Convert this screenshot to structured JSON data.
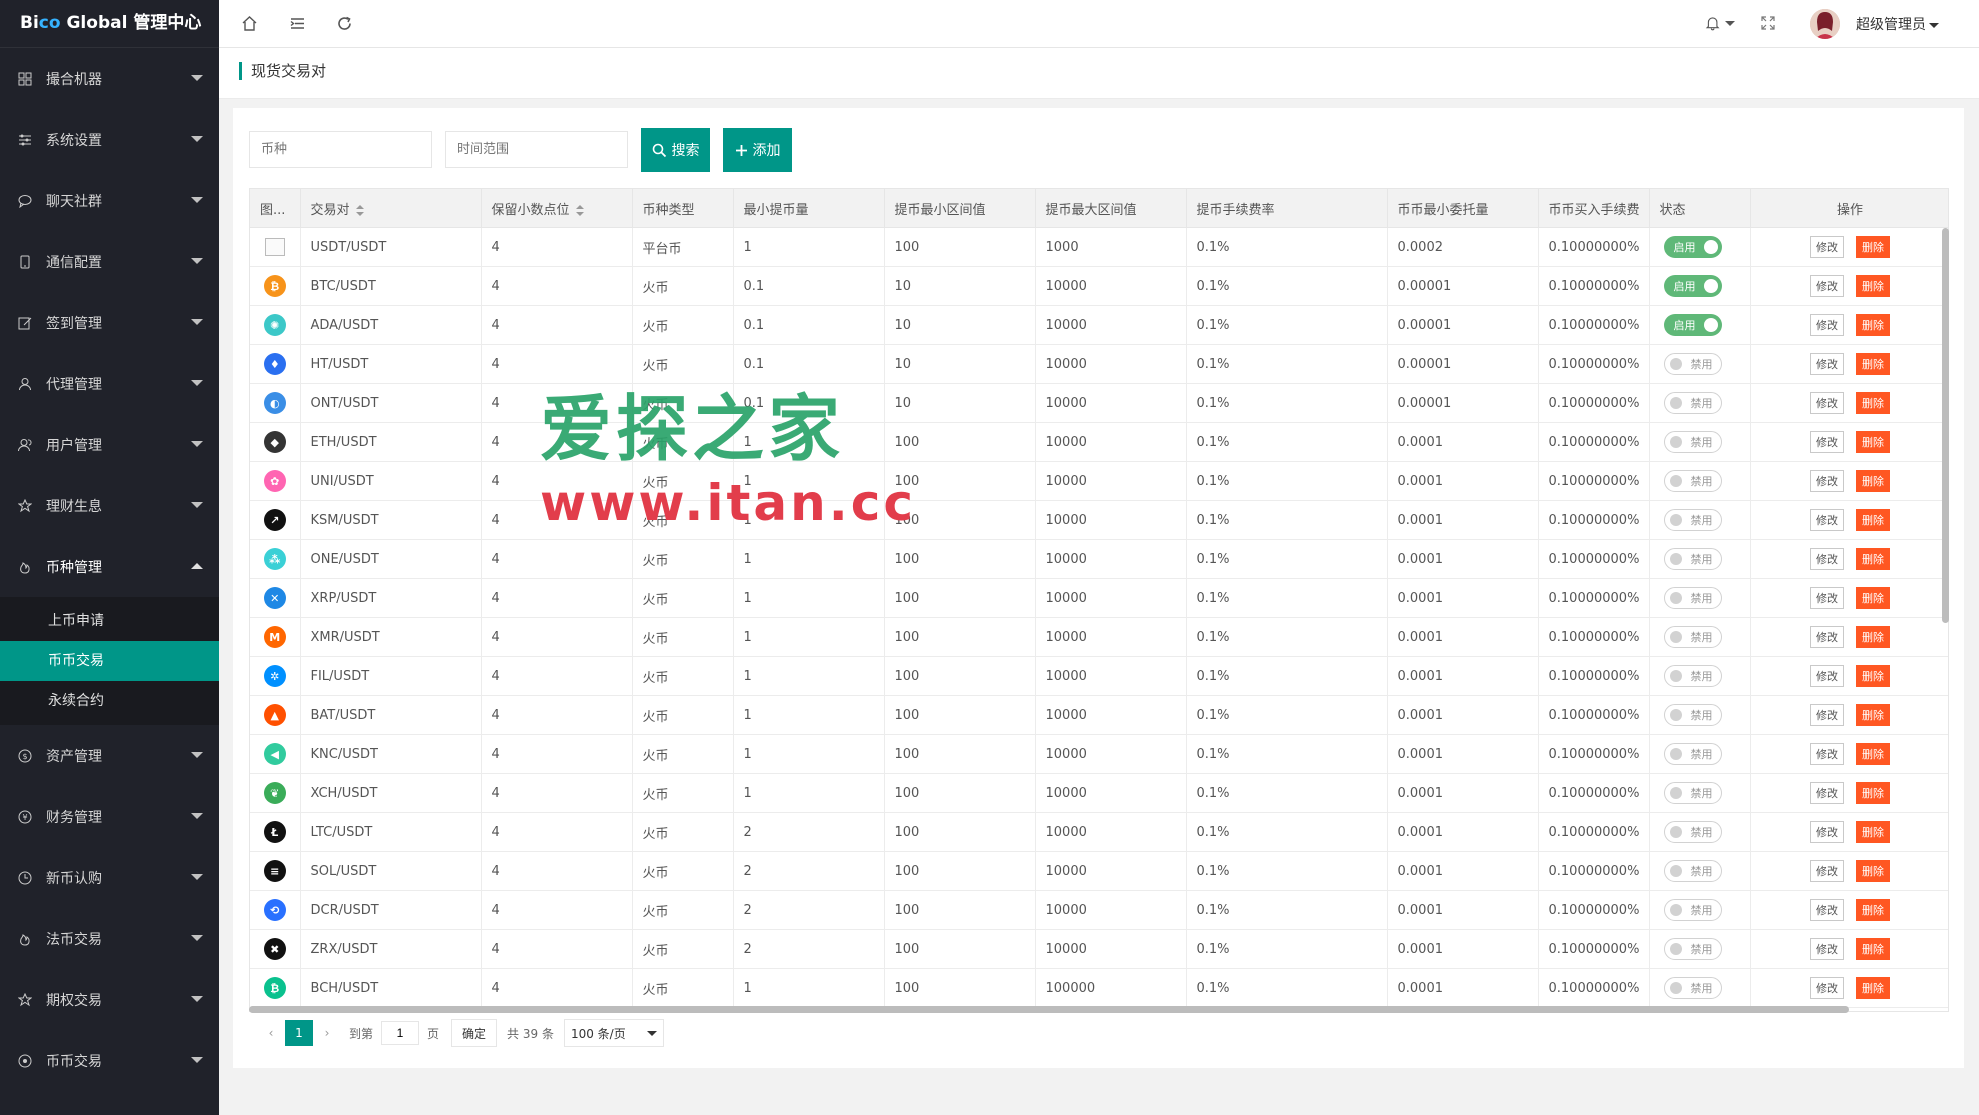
{
  "app": {
    "logo_prefix": "Bi",
    "logo_co": "co",
    "logo_suffix": " Global 管理中心"
  },
  "sidebar": {
    "items": [
      {
        "label": "撮合机器",
        "icon": "grid-icon"
      },
      {
        "label": "系统设置",
        "icon": "sliders-icon"
      },
      {
        "label": "聊天社群",
        "icon": "chat-icon"
      },
      {
        "label": "通信配置",
        "icon": "phone-icon"
      },
      {
        "label": "签到管理",
        "icon": "edit-icon"
      },
      {
        "label": "代理管理",
        "icon": "user-icon"
      },
      {
        "label": "用户管理",
        "icon": "users-icon"
      },
      {
        "label": "理财生息",
        "icon": "star-icon"
      },
      {
        "label": "币种管理",
        "icon": "fire-icon"
      }
    ],
    "submenu": [
      "上币申请",
      "币币交易",
      "永续合约"
    ],
    "items_after": [
      {
        "label": "资产管理",
        "icon": "dollar-icon"
      },
      {
        "label": "财务管理",
        "icon": "yen-icon"
      },
      {
        "label": "新币认购",
        "icon": "clock-icon"
      },
      {
        "label": "法币交易",
        "icon": "fire-icon"
      },
      {
        "label": "期权交易",
        "icon": "star-icon"
      },
      {
        "label": "币币交易",
        "icon": "target-icon"
      }
    ]
  },
  "topbar": {
    "admin_name": "超级管理员"
  },
  "breadcrumb": "现货交易对",
  "filters": {
    "coin_placeholder": "币种",
    "time_placeholder": "时间范围",
    "search_label": "搜索",
    "add_label": "添加"
  },
  "table": {
    "headers": [
      "图...",
      "交易对",
      "保留小数点位",
      "币种类型",
      "最小提币量",
      "提币最小区间值",
      "提币最大区间值",
      "提币手续费率",
      "币币最小委托量",
      "币币买入手续费",
      "状态",
      "操作"
    ],
    "edit_label": "修改",
    "delete_label": "删除",
    "on_label": "启用",
    "off_label": "禁用",
    "rows": [
      {
        "icon": "broken-image-icon",
        "color": "#ffffff",
        "pair": "USDT/USDT",
        "decimals": "4",
        "type": "平台币",
        "min_withdraw": "1",
        "min_range": "100",
        "max_range": "1000",
        "fee_rate": "0.1%",
        "min_order": "0.0002",
        "buy_fee": "0.10000000%",
        "status": "on"
      },
      {
        "icon": "btc-icon",
        "color": "#f7931a",
        "pair": "BTC/USDT",
        "decimals": "4",
        "type": "火币",
        "min_withdraw": "0.1",
        "min_range": "10",
        "max_range": "10000",
        "fee_rate": "0.1%",
        "min_order": "0.00001",
        "buy_fee": "0.10000000%",
        "status": "on"
      },
      {
        "icon": "ada-icon",
        "color": "#3cc8c8",
        "pair": "ADA/USDT",
        "decimals": "4",
        "type": "火币",
        "min_withdraw": "0.1",
        "min_range": "10",
        "max_range": "10000",
        "fee_rate": "0.1%",
        "min_order": "0.00001",
        "buy_fee": "0.10000000%",
        "status": "on"
      },
      {
        "icon": "ht-icon",
        "color": "#2a6ff0",
        "pair": "HT/USDT",
        "decimals": "4",
        "type": "火币",
        "min_withdraw": "0.1",
        "min_range": "10",
        "max_range": "10000",
        "fee_rate": "0.1%",
        "min_order": "0.00001",
        "buy_fee": "0.10000000%",
        "status": "off"
      },
      {
        "icon": "ont-icon",
        "color": "#3a8ee6",
        "pair": "ONT/USDT",
        "decimals": "4",
        "type": "火币",
        "min_withdraw": "0.1",
        "min_range": "10",
        "max_range": "10000",
        "fee_rate": "0.1%",
        "min_order": "0.00001",
        "buy_fee": "0.10000000%",
        "status": "off"
      },
      {
        "icon": "eth-icon",
        "color": "#343434",
        "pair": "ETH/USDT",
        "decimals": "4",
        "type": "火币",
        "min_withdraw": "1",
        "min_range": "100",
        "max_range": "10000",
        "fee_rate": "0.1%",
        "min_order": "0.0001",
        "buy_fee": "0.10000000%",
        "status": "off"
      },
      {
        "icon": "uni-icon",
        "color": "#ff65b2",
        "pair": "UNI/USDT",
        "decimals": "4",
        "type": "火币",
        "min_withdraw": "1",
        "min_range": "100",
        "max_range": "10000",
        "fee_rate": "0.1%",
        "min_order": "0.0001",
        "buy_fee": "0.10000000%",
        "status": "off"
      },
      {
        "icon": "ksm-icon",
        "color": "#111111",
        "pair": "KSM/USDT",
        "decimals": "4",
        "type": "火币",
        "min_withdraw": "1",
        "min_range": "100",
        "max_range": "10000",
        "fee_rate": "0.1%",
        "min_order": "0.0001",
        "buy_fee": "0.10000000%",
        "status": "off"
      },
      {
        "icon": "one-icon",
        "color": "#3ad0d6",
        "pair": "ONE/USDT",
        "decimals": "4",
        "type": "火币",
        "min_withdraw": "1",
        "min_range": "100",
        "max_range": "10000",
        "fee_rate": "0.1%",
        "min_order": "0.0001",
        "buy_fee": "0.10000000%",
        "status": "off"
      },
      {
        "icon": "xrp-icon",
        "color": "#1e88e5",
        "pair": "XRP/USDT",
        "decimals": "4",
        "type": "火币",
        "min_withdraw": "1",
        "min_range": "100",
        "max_range": "10000",
        "fee_rate": "0.1%",
        "min_order": "0.0001",
        "buy_fee": "0.10000000%",
        "status": "off"
      },
      {
        "icon": "xmr-icon",
        "color": "#ff6600",
        "pair": "XMR/USDT",
        "decimals": "4",
        "type": "火币",
        "min_withdraw": "1",
        "min_range": "100",
        "max_range": "10000",
        "fee_rate": "0.1%",
        "min_order": "0.0001",
        "buy_fee": "0.10000000%",
        "status": "off"
      },
      {
        "icon": "fil-icon",
        "color": "#0090ff",
        "pair": "FIL/USDT",
        "decimals": "4",
        "type": "火币",
        "min_withdraw": "1",
        "min_range": "100",
        "max_range": "10000",
        "fee_rate": "0.1%",
        "min_order": "0.0001",
        "buy_fee": "0.10000000%",
        "status": "off"
      },
      {
        "icon": "bat-icon",
        "color": "#ff5000",
        "pair": "BAT/USDT",
        "decimals": "4",
        "type": "火币",
        "min_withdraw": "1",
        "min_range": "100",
        "max_range": "10000",
        "fee_rate": "0.1%",
        "min_order": "0.0001",
        "buy_fee": "0.10000000%",
        "status": "off"
      },
      {
        "icon": "knc-icon",
        "color": "#31cb9e",
        "pair": "KNC/USDT",
        "decimals": "4",
        "type": "火币",
        "min_withdraw": "1",
        "min_range": "100",
        "max_range": "10000",
        "fee_rate": "0.1%",
        "min_order": "0.0001",
        "buy_fee": "0.10000000%",
        "status": "off"
      },
      {
        "icon": "xch-icon",
        "color": "#3aac59",
        "pair": "XCH/USDT",
        "decimals": "4",
        "type": "火币",
        "min_withdraw": "1",
        "min_range": "100",
        "max_range": "10000",
        "fee_rate": "0.1%",
        "min_order": "0.0001",
        "buy_fee": "0.10000000%",
        "status": "off"
      },
      {
        "icon": "ltc-icon",
        "color": "#111111",
        "pair": "LTC/USDT",
        "decimals": "4",
        "type": "火币",
        "min_withdraw": "2",
        "min_range": "100",
        "max_range": "10000",
        "fee_rate": "0.1%",
        "min_order": "0.0001",
        "buy_fee": "0.10000000%",
        "status": "off"
      },
      {
        "icon": "sol-icon",
        "color": "#111111",
        "pair": "SOL/USDT",
        "decimals": "4",
        "type": "火币",
        "min_withdraw": "2",
        "min_range": "100",
        "max_range": "10000",
        "fee_rate": "0.1%",
        "min_order": "0.0001",
        "buy_fee": "0.10000000%",
        "status": "off"
      },
      {
        "icon": "dcr-icon",
        "color": "#2970ff",
        "pair": "DCR/USDT",
        "decimals": "4",
        "type": "火币",
        "min_withdraw": "2",
        "min_range": "100",
        "max_range": "10000",
        "fee_rate": "0.1%",
        "min_order": "0.0001",
        "buy_fee": "0.10000000%",
        "status": "off"
      },
      {
        "icon": "zrx-icon",
        "color": "#111111",
        "pair": "ZRX/USDT",
        "decimals": "4",
        "type": "火币",
        "min_withdraw": "2",
        "min_range": "100",
        "max_range": "10000",
        "fee_rate": "0.1%",
        "min_order": "0.0001",
        "buy_fee": "0.10000000%",
        "status": "off"
      },
      {
        "icon": "bch-icon",
        "color": "#0ac18e",
        "pair": "BCH/USDT",
        "decimals": "4",
        "type": "火币",
        "min_withdraw": "1",
        "min_range": "100",
        "max_range": "100000",
        "fee_rate": "0.1%",
        "min_order": "0.0001",
        "buy_fee": "0.10000000%",
        "status": "off"
      }
    ]
  },
  "pager": {
    "current": "1",
    "goto_label": "到第",
    "goto_value": "1",
    "page_label": "页",
    "ok_label": "确定",
    "total": "共 39 条",
    "page_size": "100 条/页"
  },
  "watermark": {
    "line1": "爱探之家",
    "line2": "www.itan.cc"
  }
}
